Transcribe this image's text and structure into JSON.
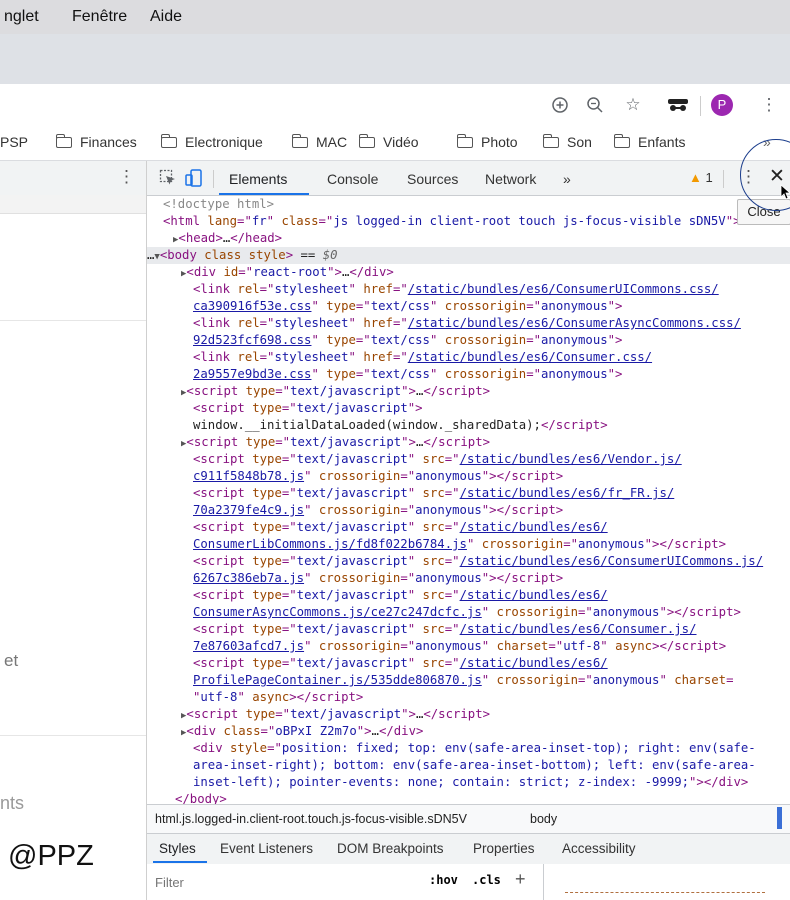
{
  "menu": [
    "nglet",
    "Fenêtre",
    "Aide"
  ],
  "toolbar_icons": [
    "zoom-icon",
    "search-icon",
    "star-icon",
    "incognito-icon",
    "avatar",
    "more-icon"
  ],
  "avatar_letter": "P",
  "bookmarks": [
    {
      "label": "PSP",
      "folder": false
    },
    {
      "label": "Finances",
      "folder": true
    },
    {
      "label": "Electronique",
      "folder": true
    },
    {
      "label": "MAC",
      "folder": true
    },
    {
      "label": "Vidéo",
      "folder": true
    },
    {
      "label": "Photo",
      "folder": true
    },
    {
      "label": "Son",
      "folder": true
    },
    {
      "label": "Enfants",
      "folder": true
    },
    {
      "label": "»",
      "folder": false
    }
  ],
  "left_page": {
    "text1": "et",
    "text2": "nts",
    "watermark": "@PPZ"
  },
  "devtools": {
    "tabs": [
      "Elements",
      "Console",
      "Sources",
      "Network",
      "»"
    ],
    "active_tab": "Elements",
    "warning_count": "1",
    "close_tooltip": "Close",
    "breadcrumb": [
      "html.js.logged-in.client-root.touch.js-focus-visible.sDN5V",
      "body"
    ],
    "subtabs": [
      "Styles",
      "Event Listeners",
      "DOM Breakpoints",
      "Properties",
      "Accessibility"
    ],
    "filter_placeholder": "Filter",
    "hov": ":hov",
    "cls": ".cls",
    "plus": "+"
  }
}
